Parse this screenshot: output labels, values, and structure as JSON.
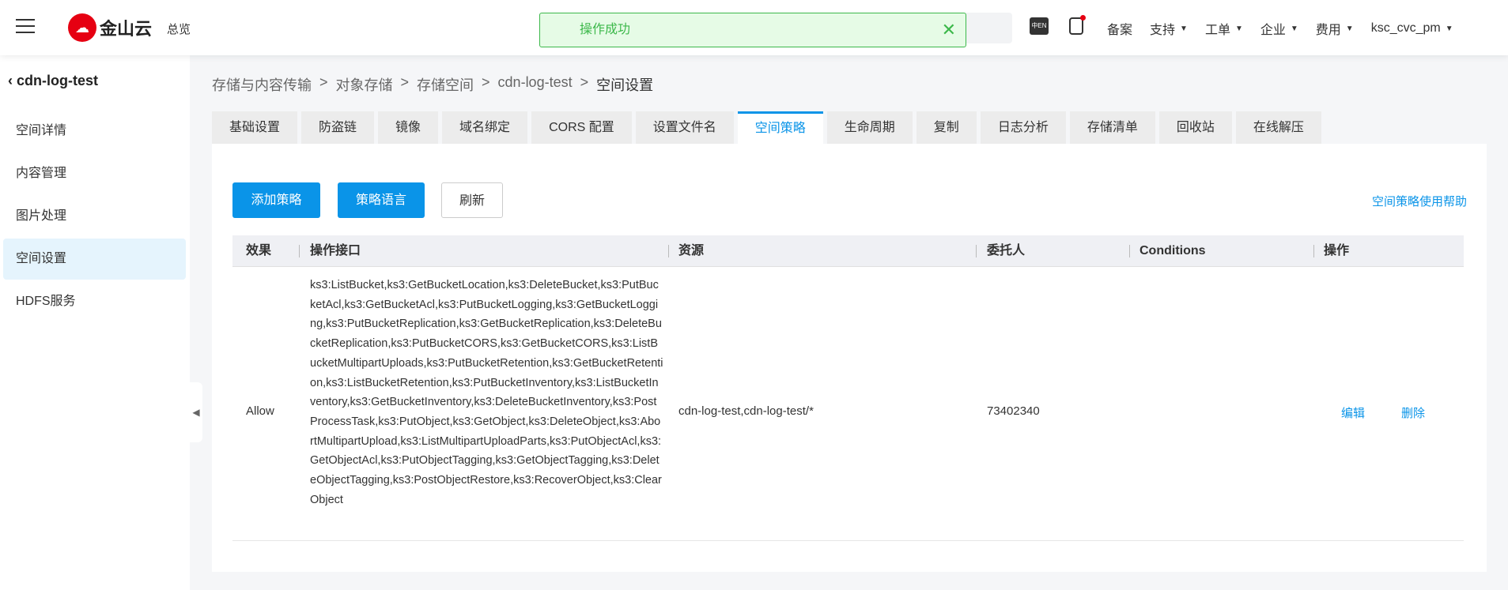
{
  "header": {
    "brand": "金山云",
    "overview": "总览",
    "toast": "操作成功",
    "nav": [
      {
        "label": "备案",
        "caret": false
      },
      {
        "label": "支持",
        "caret": true
      },
      {
        "label": "工单",
        "caret": true
      },
      {
        "label": "企业",
        "caret": true
      },
      {
        "label": "费用",
        "caret": true
      },
      {
        "label": "ksc_cvc_pm",
        "caret": true
      }
    ],
    "lang_icon": "中EN"
  },
  "sidebar": {
    "title": "cdn-log-test",
    "items": [
      "空间详情",
      "内容管理",
      "图片处理",
      "空间设置",
      "HDFS服务"
    ],
    "active": "空间设置"
  },
  "breadcrumb": [
    "存储与内容传输",
    "对象存储",
    "存储空间",
    "cdn-log-test",
    "空间设置"
  ],
  "tabs": [
    "基础设置",
    "防盗链",
    "镜像",
    "域名绑定",
    "CORS 配置",
    "设置文件名",
    "空间策略",
    "生命周期",
    "复制",
    "日志分析",
    "存储清单",
    "回收站",
    "在线解压"
  ],
  "active_tab": "空间策略",
  "toolbar": {
    "add": "添加策略",
    "lang": "策略语言",
    "refresh": "刷新",
    "help": "空间策略使用帮助"
  },
  "table": {
    "headers": [
      "效果",
      "操作接口",
      "资源",
      "委托人",
      "Conditions",
      "操作"
    ],
    "rows": [
      {
        "effect": "Allow",
        "actions": "ks3:ListBucket,ks3:GetBucketLocation,ks3:DeleteBucket,ks3:PutBucketAcl,ks3:GetBucketAcl,ks3:PutBucketLogging,ks3:GetBucketLogging,ks3:PutBucketReplication,ks3:GetBucketReplication,ks3:DeleteBucketReplication,ks3:PutBucketCORS,ks3:GetBucketCORS,ks3:ListBucketMultipartUploads,ks3:PutBucketRetention,ks3:GetBucketRetention,ks3:ListBucketRetention,ks3:PutBucketInventory,ks3:ListBucketInventory,ks3:GetBucketInventory,ks3:DeleteBucketInventory,ks3:PostProcessTask,ks3:PutObject,ks3:GetObject,ks3:DeleteObject,ks3:AbortMultipartUpload,ks3:ListMultipartUploadParts,ks3:PutObjectAcl,ks3:GetObjectAcl,ks3:PutObjectTagging,ks3:GetObjectTagging,ks3:DeleteObjectTagging,ks3:PostObjectRestore,ks3:RecoverObject,ks3:ClearObject",
        "resource": "cdn-log-test,cdn-log-test/*",
        "principal": "73402340",
        "conditions": "",
        "edit": "编辑",
        "delete": "删除"
      }
    ]
  },
  "colors": {
    "accent": "#0a94e8",
    "success": "#3cb84a",
    "brand": "#e60012"
  }
}
